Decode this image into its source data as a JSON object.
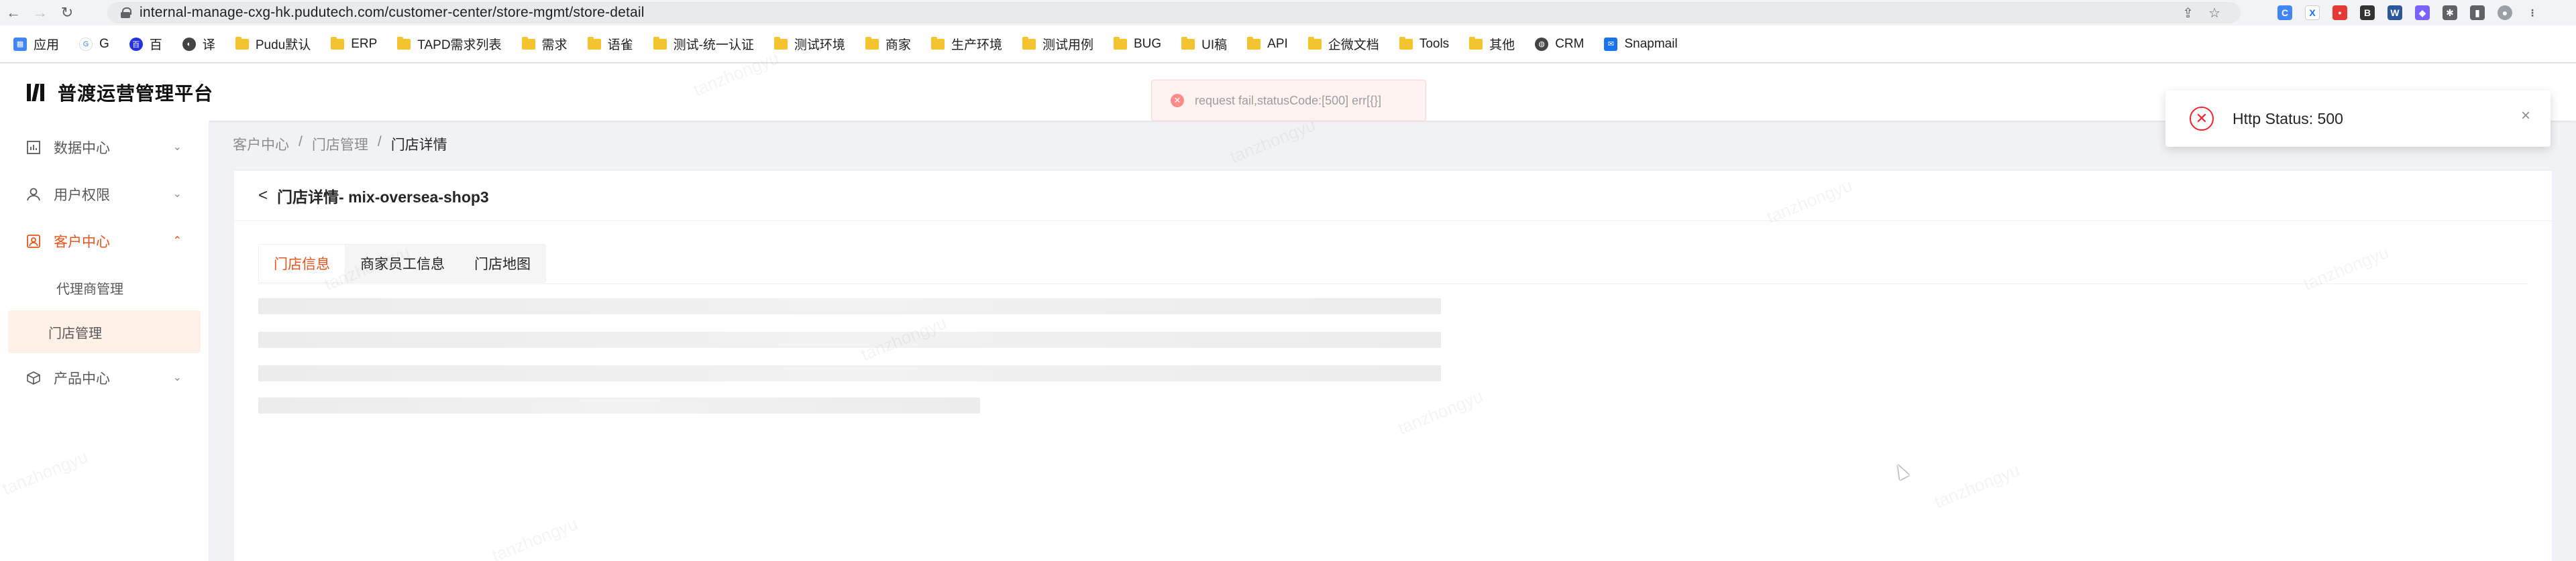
{
  "browser": {
    "url": "internal-manage-cxg-hk.pudutech.com/customer-center/store-mgmt/store-detail",
    "bookmarks": [
      {
        "label": "应用",
        "icon": "apps-icon"
      },
      {
        "label": "G",
        "icon": "google-icon"
      },
      {
        "label": "百",
        "icon": "baidu-icon"
      },
      {
        "label": "译",
        "icon": "translate-icon"
      },
      {
        "label": "Pudu默认",
        "icon": "folder-icon"
      },
      {
        "label": "ERP",
        "icon": "folder-icon"
      },
      {
        "label": "TAPD需求列表",
        "icon": "folder-icon"
      },
      {
        "label": "需求",
        "icon": "folder-icon"
      },
      {
        "label": "语雀",
        "icon": "folder-icon"
      },
      {
        "label": "测试-统一认证",
        "icon": "folder-icon"
      },
      {
        "label": "测试环境",
        "icon": "folder-icon"
      },
      {
        "label": "商家",
        "icon": "folder-icon"
      },
      {
        "label": "生产环境",
        "icon": "folder-icon"
      },
      {
        "label": "测试用例",
        "icon": "folder-icon"
      },
      {
        "label": "BUG",
        "icon": "folder-icon"
      },
      {
        "label": "UI稿",
        "icon": "folder-icon"
      },
      {
        "label": "API",
        "icon": "folder-icon"
      },
      {
        "label": "企微文档",
        "icon": "folder-icon"
      },
      {
        "label": "Tools",
        "icon": "folder-icon"
      },
      {
        "label": "其他",
        "icon": "folder-icon"
      },
      {
        "label": "CRM",
        "icon": "globe-icon"
      },
      {
        "label": "Snapmail",
        "icon": "mail-icon"
      }
    ]
  },
  "app": {
    "brand": "普渡运营管理平台"
  },
  "sidebar": {
    "items": [
      {
        "label": "数据中心",
        "icon": "chart-icon",
        "chevron": "⌄"
      },
      {
        "label": "用户权限",
        "icon": "user-icon",
        "chevron": "⌄"
      },
      {
        "label": "客户中心",
        "icon": "customer-icon",
        "chevron": "⌃"
      },
      {
        "label": "产品中心",
        "icon": "cube-icon",
        "chevron": "⌄"
      }
    ],
    "sub_items": [
      {
        "label": "代理商管理"
      },
      {
        "label": "门店管理"
      }
    ]
  },
  "breadcrumb": {
    "items": [
      "客户中心",
      "门店管理",
      "门店详情"
    ],
    "separator": "/"
  },
  "detail": {
    "title": "门店详情- mix-oversea-shop3",
    "back_glyph": "<",
    "tabs": [
      "门店信息",
      "商家员工信息",
      "门店地图"
    ]
  },
  "message": {
    "text": "request fail,statusCode:[500] err[{}]"
  },
  "notification": {
    "text": "Http Status: 500",
    "close_glyph": "×"
  },
  "watermark": "tanzhongyu",
  "colors": {
    "accent": "#e8541e",
    "error": "#f5222d",
    "active_bg": "#fff1e8"
  }
}
